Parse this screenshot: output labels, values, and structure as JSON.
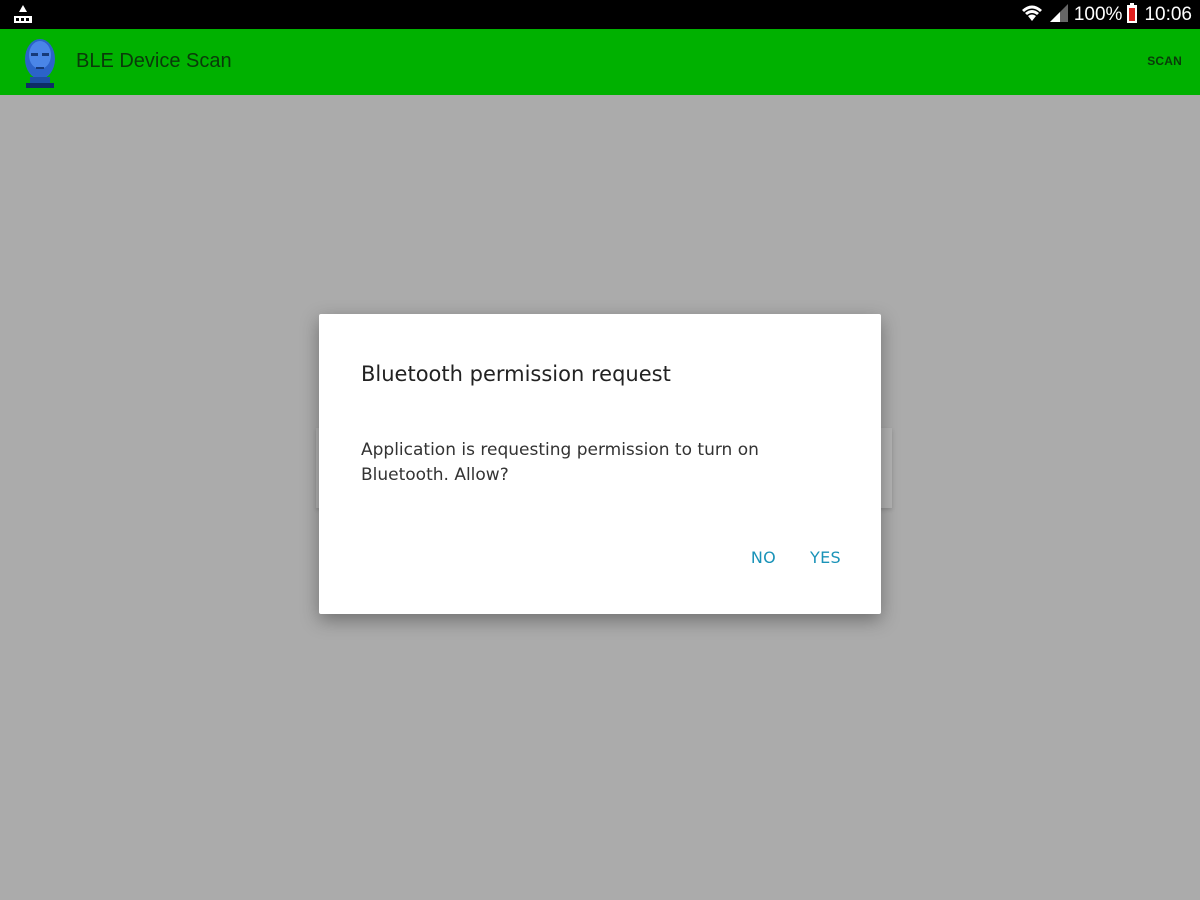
{
  "status_bar": {
    "battery_level": "100%",
    "time": "10:06",
    "left_icon": "notification-icon",
    "wifi_icon": "wifi-icon",
    "signal_icon": "cell-signal-icon",
    "battery_icon": "battery-charging-icon"
  },
  "action_bar": {
    "title": "BLE Device Scan",
    "scan_label": "SCAN",
    "color": "#00b100"
  },
  "dialog": {
    "title": "Bluetooth permission request",
    "message": "Application is requesting permission to turn on Bluetooth. Allow?",
    "no_label": "NO",
    "yes_label": "YES",
    "button_color": "#1a93b8"
  },
  "colors": {
    "scrim": "#ababab",
    "status_bar": "#000000"
  }
}
